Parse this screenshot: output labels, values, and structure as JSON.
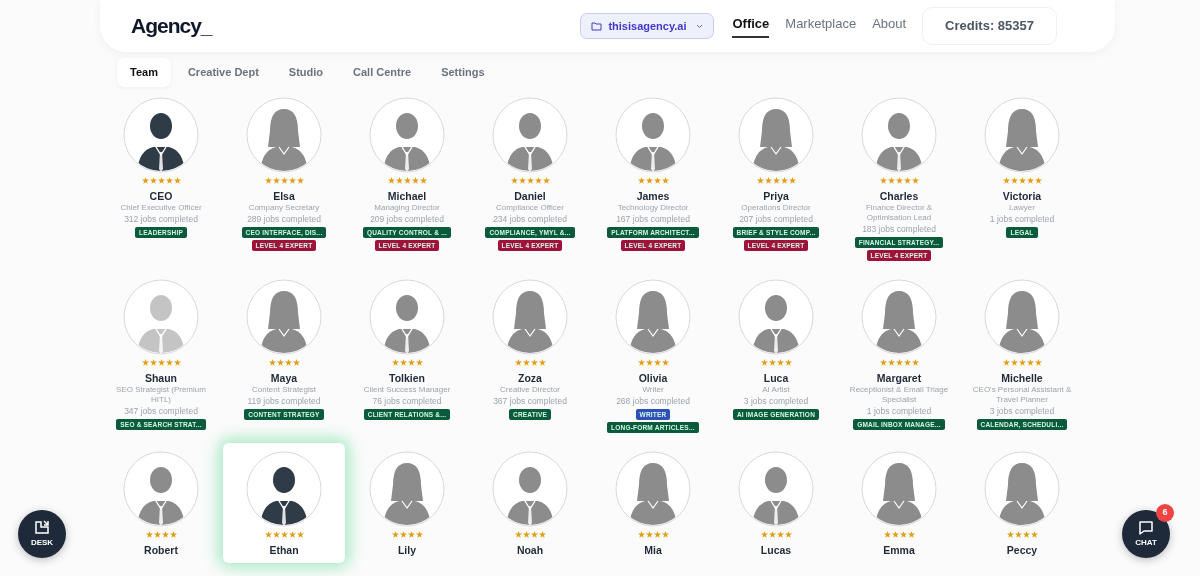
{
  "brand": "Agency_",
  "workspace": {
    "label": "thisisagency.ai"
  },
  "nav": [
    {
      "label": "Office",
      "selected": true
    },
    {
      "label": "Marketplace",
      "selected": false
    },
    {
      "label": "About",
      "selected": false
    }
  ],
  "credits": "Credits: 85357",
  "tabs": [
    {
      "label": "Team",
      "selected": true
    },
    {
      "label": "Creative Dept",
      "selected": false
    },
    {
      "label": "Studio",
      "selected": false
    },
    {
      "label": "Call Centre",
      "selected": false
    },
    {
      "label": "Settings",
      "selected": false
    }
  ],
  "team": [
    {
      "name": "CEO",
      "role": "Chief Executive Officer",
      "jobs": "312 jobs completed",
      "stars": 5,
      "kind": "male-dark",
      "selected": false,
      "tags": [
        {
          "label": "LEADERSHIP",
          "color": "#0b5a3c"
        }
      ]
    },
    {
      "name": "Elsa",
      "role": "Company Secretary",
      "jobs": "289 jobs completed",
      "stars": 5,
      "kind": "female",
      "selected": false,
      "tags": [
        {
          "label": "CEO INTERFACE, DIS...",
          "color": "#0b5a3c"
        },
        {
          "label": "LEVEL 4 EXPERT",
          "color": "#9f1239"
        }
      ]
    },
    {
      "name": "Michael",
      "role": "Managing Director",
      "jobs": "209 jobs completed",
      "stars": 5,
      "kind": "male",
      "selected": false,
      "tags": [
        {
          "label": "QUALITY CONTROL & ...",
          "color": "#0b5a3c"
        },
        {
          "label": "LEVEL 4 EXPERT",
          "color": "#9f1239"
        }
      ]
    },
    {
      "name": "Daniel",
      "role": "Compliance Officer",
      "jobs": "234 jobs completed",
      "stars": 5,
      "kind": "male",
      "selected": false,
      "tags": [
        {
          "label": "COMPLIANCE, YMYL &...",
          "color": "#0b5a3c"
        },
        {
          "label": "LEVEL 4 EXPERT",
          "color": "#9f1239"
        }
      ]
    },
    {
      "name": "James",
      "role": "Technology Director",
      "jobs": "167 jobs completed",
      "stars": 4,
      "kind": "male",
      "selected": false,
      "tags": [
        {
          "label": "PLATFORM ARCHITECT...",
          "color": "#0b5a3c"
        },
        {
          "label": "LEVEL 4 EXPERT",
          "color": "#9f1239"
        }
      ]
    },
    {
      "name": "Priya",
      "role": "Operations Director",
      "jobs": "207 jobs completed",
      "stars": 5,
      "kind": "female",
      "selected": false,
      "tags": [
        {
          "label": "BRIEF & STYLE COMP...",
          "color": "#0b5a3c"
        },
        {
          "label": "LEVEL 4 EXPERT",
          "color": "#9f1239"
        }
      ]
    },
    {
      "name": "Charles",
      "role": "Finance Director & Optimisation Lead",
      "jobs": "183 jobs completed",
      "stars": 5,
      "kind": "male",
      "selected": false,
      "tags": [
        {
          "label": "FINANCIAL STRATEGY...",
          "color": "#0b5a3c"
        },
        {
          "label": "LEVEL 4 EXPERT",
          "color": "#9f1239"
        }
      ]
    },
    {
      "name": "Victoria",
      "role": "Lawyer",
      "jobs": "1 jobs completed",
      "stars": 5,
      "kind": "female",
      "selected": false,
      "tags": [
        {
          "label": "LEGAL",
          "color": "#0b5a3c"
        }
      ]
    },
    {
      "name": "Shaun",
      "role": "SEO Strategist (Premium HITL)",
      "jobs": "347 jobs completed",
      "stars": 5,
      "kind": "male-light",
      "selected": false,
      "tags": [
        {
          "label": "SEO & SEARCH STRAT...",
          "color": "#0b5a3c"
        }
      ]
    },
    {
      "name": "Maya",
      "role": "Content Strategist",
      "jobs": "119 jobs completed",
      "stars": 4,
      "kind": "female",
      "selected": false,
      "tags": [
        {
          "label": "CONTENT STRATEGY",
          "color": "#0b5a3c"
        }
      ]
    },
    {
      "name": "Tolkien",
      "role": "Client Success Manager",
      "jobs": "76 jobs completed",
      "stars": 4,
      "kind": "male",
      "selected": false,
      "tags": [
        {
          "label": "CLIENT RELATIONS &...",
          "color": "#0b5a3c"
        }
      ]
    },
    {
      "name": "Zoza",
      "role": "Creative Director",
      "jobs": "367 jobs completed",
      "stars": 4,
      "kind": "female",
      "selected": false,
      "tags": [
        {
          "label": "CREATIVE",
          "color": "#0b5a3c"
        }
      ]
    },
    {
      "name": "Olivia",
      "role": "Writer",
      "jobs": "268 jobs completed",
      "stars": 4,
      "kind": "female",
      "selected": false,
      "tags": [
        {
          "label": "WRITER",
          "color": "#2f4fb8"
        },
        {
          "label": "LONG-FORM ARTICLES...",
          "color": "#0b5a3c"
        }
      ]
    },
    {
      "name": "Luca",
      "role": "AI Artist",
      "jobs": "3 jobs completed",
      "stars": 4,
      "kind": "male",
      "selected": false,
      "tags": [
        {
          "label": "AI IMAGE GENERATION",
          "color": "#0b5a3c"
        }
      ]
    },
    {
      "name": "Margaret",
      "role": "Receptionist & Email Triage Specialist",
      "jobs": "1 jobs completed",
      "stars": 5,
      "kind": "female",
      "selected": false,
      "tags": [
        {
          "label": "GMAIL INBOX MANAGE...",
          "color": "#0b5a3c"
        }
      ]
    },
    {
      "name": "Michelle",
      "role": "CEO's Personal Assistant & Travel Planner",
      "jobs": "3 jobs completed",
      "stars": 5,
      "kind": "female",
      "selected": false,
      "tags": [
        {
          "label": "CALENDAR, SCHEDULI...",
          "color": "#0b5a3c"
        }
      ]
    },
    {
      "name": "Robert",
      "stars": 4,
      "kind": "male",
      "selected": false
    },
    {
      "name": "Ethan",
      "stars": 5,
      "kind": "male-dark",
      "selected": true
    },
    {
      "name": "Lily",
      "stars": 4,
      "kind": "female",
      "selected": false
    },
    {
      "name": "Noah",
      "stars": 4,
      "kind": "male",
      "selected": false
    },
    {
      "name": "Mia",
      "stars": 4,
      "kind": "female",
      "selected": false
    },
    {
      "name": "Lucas",
      "stars": 4,
      "kind": "male",
      "selected": false
    },
    {
      "name": "Emma",
      "stars": 4,
      "kind": "female",
      "selected": false
    },
    {
      "name": "Peccy",
      "stars": 4,
      "kind": "female",
      "selected": false
    }
  ],
  "desk_button": {
    "label": "DESK"
  },
  "chat_button": {
    "label": "CHAT",
    "count": "6"
  }
}
